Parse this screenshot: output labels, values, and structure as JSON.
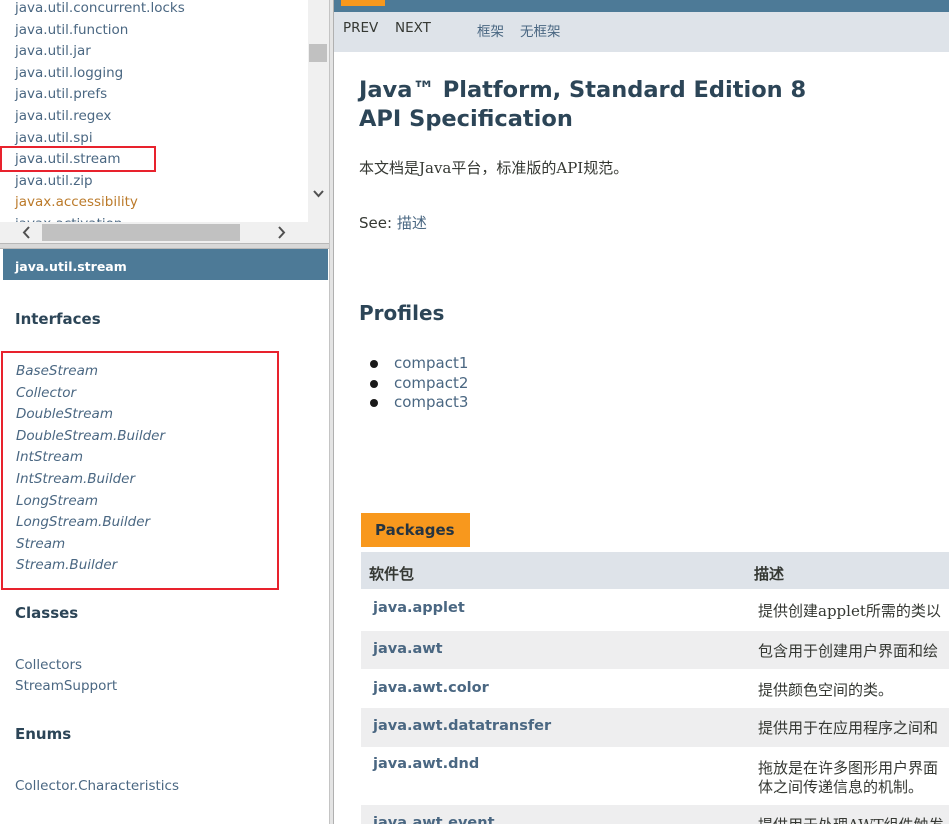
{
  "package_list": {
    "items": [
      {
        "label": "java.util.concurrent.locks",
        "visited": false
      },
      {
        "label": "java.util.function",
        "visited": false
      },
      {
        "label": "java.util.jar",
        "visited": false
      },
      {
        "label": "java.util.logging",
        "visited": false
      },
      {
        "label": "java.util.prefs",
        "visited": false
      },
      {
        "label": "java.util.regex",
        "visited": false
      },
      {
        "label": "java.util.spi",
        "visited": false
      },
      {
        "label": "java.util.stream",
        "visited": false
      },
      {
        "label": "java.util.zip",
        "visited": false
      },
      {
        "label": "javax.accessibility",
        "visited": true
      },
      {
        "label": "javax.activation",
        "visited": false
      }
    ]
  },
  "package_frame": {
    "title": "java.util.stream",
    "interfaces_heading": "Interfaces",
    "interfaces": [
      "BaseStream",
      "Collector",
      "DoubleStream",
      "DoubleStream.Builder",
      "IntStream",
      "IntStream.Builder",
      "LongStream",
      "LongStream.Builder",
      "Stream",
      "Stream.Builder"
    ],
    "classes_heading": "Classes",
    "classes": [
      "Collectors",
      "StreamSupport"
    ],
    "enums_heading": "Enums",
    "enums": [
      "Collector.Characteristics"
    ]
  },
  "main": {
    "subnav": {
      "prev": "PREV",
      "next": "NEXT",
      "frames": "框架",
      "no_frames": "无框架"
    },
    "title_line1": "Java™ Platform, Standard Edition 8",
    "title_line2": "API Specification",
    "intro": "本文档是Java平台，标准版的API规范。",
    "see_label": "See:",
    "see_link": "描述",
    "profiles_heading": "Profiles",
    "profiles": [
      "compact1",
      "compact2",
      "compact3"
    ],
    "packages_caption": "Packages",
    "table_headers": {
      "package": "软件包",
      "description": "描述"
    },
    "table_rows": [
      {
        "name": "java.applet",
        "desc": "提供创建applet所需的类以"
      },
      {
        "name": "java.awt",
        "desc": "包含用于创建用户界面和绘"
      },
      {
        "name": "java.awt.color",
        "desc": "提供颜色空间的类。"
      },
      {
        "name": "java.awt.datatransfer",
        "desc": "提供用于在应用程序之间和"
      },
      {
        "name": "java.awt.dnd",
        "desc": "拖放是在许多图形用户界面",
        "desc2": "体之间传递信息的机制。"
      },
      {
        "name": "java.awt.event",
        "desc": "提供用于处理AWT组件触发"
      }
    ]
  },
  "colors": {
    "accent": "#f8981d",
    "header_blue": "#4d7a97",
    "link": "#4a6782",
    "highlight_box": "#e8222d"
  }
}
